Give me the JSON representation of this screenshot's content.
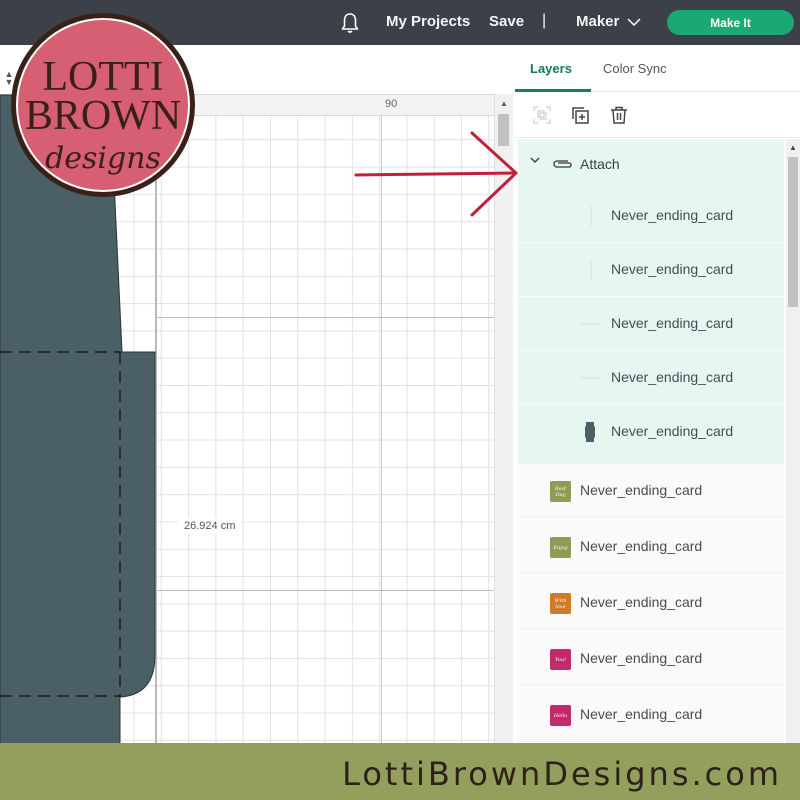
{
  "topbar": {
    "notifications_icon": "bell-icon",
    "my_projects_label": "My Projects",
    "save_label": "Save",
    "separator": "|",
    "machine_label": "Maker",
    "make_it_label": "Make It",
    "colors": {
      "background": "#3c4149",
      "make_it": "#1aa874"
    }
  },
  "canvas": {
    "ruler_label": "90",
    "dimension_label": "26.924 cm",
    "shape_color": "#4b5f66"
  },
  "panel": {
    "tabs": [
      {
        "label": "Layers",
        "active": true
      },
      {
        "label": "Color Sync",
        "active": false
      }
    ],
    "tools": [
      {
        "icon": "group-icon",
        "enabled": false
      },
      {
        "icon": "duplicate-icon",
        "enabled": true
      },
      {
        "icon": "delete-icon",
        "enabled": true
      }
    ],
    "group": {
      "label": "Attach",
      "icon": "attach-clip-icon",
      "expanded": true,
      "children": [
        {
          "name": "Never_ending_card",
          "thumb": "vertical-line"
        },
        {
          "name": "Never_ending_card",
          "thumb": "vertical-line"
        },
        {
          "name": "Never_ending_card",
          "thumb": "horizontal-line"
        },
        {
          "name": "Never_ending_card",
          "thumb": "horizontal-line"
        },
        {
          "name": "Never_ending_card",
          "thumb": "card-shape",
          "color": "#4b5f66"
        }
      ]
    },
    "layers": [
      {
        "name": "Never_ending_card",
        "thumb_text": "Best Day",
        "color": "#8e9c57"
      },
      {
        "name": "Never_ending_card",
        "thumb_text": "Enjoy",
        "color": "#8e9c57"
      },
      {
        "name": "Never_ending_card",
        "thumb_text": "With love",
        "color": "#d07a2a"
      },
      {
        "name": "Never_ending_card",
        "thumb_text": "You!",
        "color": "#c22a6a"
      },
      {
        "name": "Never_ending_card",
        "thumb_text": "Hello",
        "color": "#c22a6a"
      }
    ]
  },
  "watermark": {
    "logo_line1": "LOTTI",
    "logo_line2": "BROWN",
    "logo_line3": "designs",
    "logo_color": "#d65f73",
    "footer_text": "LottiBrownDesigns.com",
    "footer_color": "#93a05d"
  }
}
